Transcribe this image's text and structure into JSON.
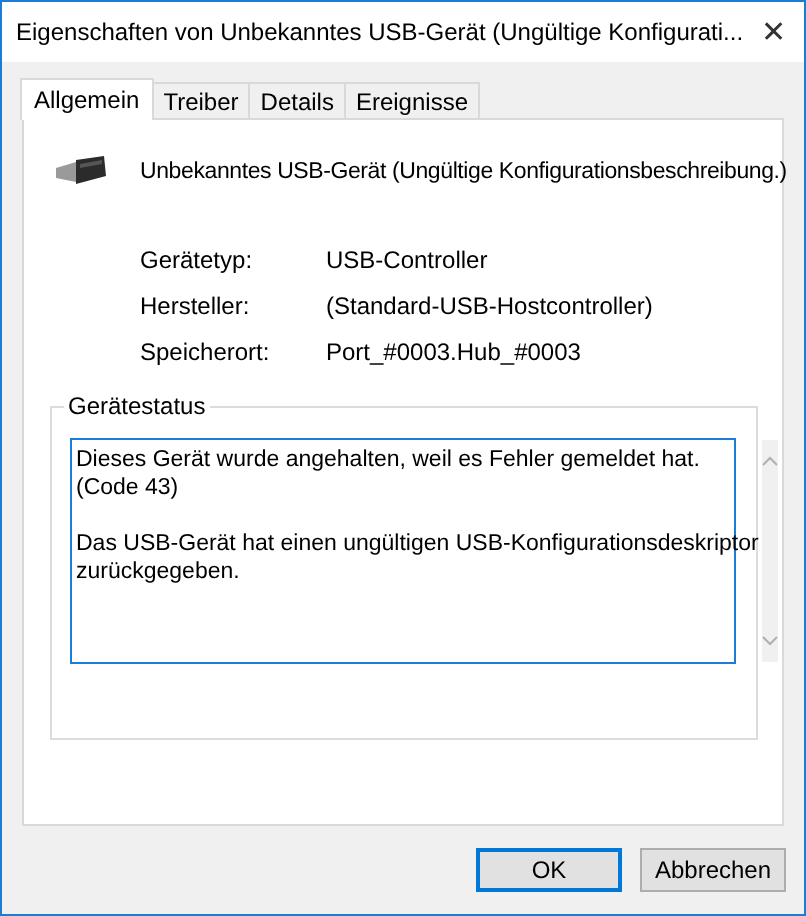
{
  "window": {
    "title": "Eigenschaften von Unbekanntes USB-Gerät (Ungültige Konfigurati..."
  },
  "close_button": {
    "label": "✕"
  },
  "tabs": [
    {
      "label": "Allgemein",
      "selected": true
    },
    {
      "label": "Treiber",
      "selected": false
    },
    {
      "label": "Details",
      "selected": false
    },
    {
      "label": "Ereignisse",
      "selected": false
    }
  ],
  "device_name": "Unbekanntes USB-Gerät (Ungültige Konfigurationsbeschreibung.)",
  "properties": [
    {
      "label": "Gerätetyp:",
      "value": "USB-Controller"
    },
    {
      "label": "Hersteller:",
      "value": "(Standard-USB-Hostcontroller)"
    },
    {
      "label": "Speicherort:",
      "value": "Port_#0003.Hub_#0003"
    }
  ],
  "status_group": {
    "title": "Gerätestatus",
    "paragraphs": [
      [
        "Dieses Gerät wurde angehalten, weil es Fehler gemeldet hat.",
        "(Code 43)"
      ],
      [
        "Das USB-Gerät hat einen ungültigen USB-Konfigurationsdeskriptor",
        "zurückgegeben."
      ]
    ]
  },
  "buttons": [
    {
      "label": "OK",
      "default": true
    },
    {
      "label": "Abbrechen",
      "default": false
    }
  ]
}
